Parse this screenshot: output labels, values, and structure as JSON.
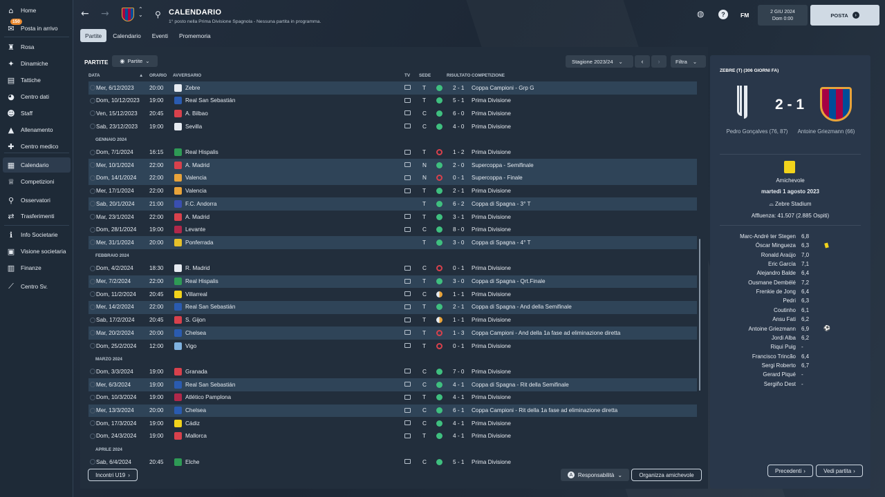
{
  "sidebar": [
    {
      "label": "Home",
      "icon": "home-icon"
    },
    {
      "label": "Posta in arrivo",
      "icon": "inbox-icon",
      "badge": "150"
    },
    {
      "label": "Rosa",
      "icon": "shirt-icon"
    },
    {
      "label": "Dinamiche",
      "icon": "megaphone-icon"
    },
    {
      "label": "Tattiche",
      "icon": "clipboard-icon"
    },
    {
      "label": "Centro dati",
      "icon": "data-icon"
    },
    {
      "label": "Staff",
      "icon": "staff-icon"
    },
    {
      "label": "Allenamento",
      "icon": "training-icon"
    },
    {
      "label": "Centro medico",
      "icon": "medical-icon"
    },
    {
      "label": "Calendario",
      "icon": "calendar-icon",
      "active": true
    },
    {
      "label": "Competizioni",
      "icon": "trophy-icon"
    },
    {
      "label": "Osservatori",
      "icon": "binoculars-icon"
    },
    {
      "label": "Trasferimenti",
      "icon": "transfer-icon"
    },
    {
      "label": "Info Societarie",
      "icon": "info-icon"
    },
    {
      "label": "Visione societaria",
      "icon": "briefcase-icon"
    },
    {
      "label": "Finanze",
      "icon": "finance-icon"
    },
    {
      "label": "Centro Sv.",
      "icon": "dev-center-icon"
    }
  ],
  "header": {
    "title": "CALENDARIO",
    "subtitle": "1° posto nella Prima Divisione Spagnola - Nessuna partita in programma.",
    "fm": "FM",
    "date": "2 GIU 2024",
    "time": "Dom 0:00",
    "posta": "POSTA"
  },
  "tabs": [
    "Partite",
    "Calendario",
    "Eventi",
    "Promemoria"
  ],
  "main": {
    "section_title": "PARTITE",
    "view_dropdown": "Partite",
    "season": "Stagione 2023/24",
    "filter": "Filtra",
    "columns": {
      "date": "DATA",
      "time": "ORARIO",
      "opponent": "AVVERSARIO",
      "tv": "TV",
      "venue": "SEDE",
      "result": "RISULTATO",
      "competition": "COMPETIZIONE"
    },
    "rows": [
      {
        "date": "Mer, 6/12/2023",
        "time": "20:00",
        "opp": "Zebre",
        "crest": "#e6ebf1",
        "tv": true,
        "venue": "T",
        "res": "w",
        "score": "2 - 1",
        "comp": "Coppa Campioni - Grp G",
        "hl": true
      },
      {
        "date": "Dom, 10/12/2023",
        "time": "19:00",
        "opp": "Real San Sebastián",
        "crest": "#2a5bb0",
        "tv": true,
        "venue": "T",
        "res": "w",
        "score": "5 - 1",
        "comp": "Prima Divisione"
      },
      {
        "date": "Ven, 15/12/2023",
        "time": "20:45",
        "opp": "A. Bilbao",
        "crest": "#d8414c",
        "tv": true,
        "venue": "C",
        "res": "w",
        "score": "6 - 0",
        "comp": "Prima Divisione"
      },
      {
        "date": "Sab, 23/12/2023",
        "time": "19:00",
        "opp": "Sevilla",
        "crest": "#e6ebf1",
        "tv": true,
        "venue": "C",
        "res": "w",
        "score": "4 - 0",
        "comp": "Prima Divisione"
      },
      {
        "month": "GENNAIO 2024"
      },
      {
        "date": "Dom, 7/1/2024",
        "time": "16:15",
        "opp": "Real Hispalis",
        "crest": "#2e9a55",
        "tv": true,
        "venue": "T",
        "res": "l",
        "score": "1 - 2",
        "comp": "Prima Divisione"
      },
      {
        "date": "Mer, 10/1/2024",
        "time": "22:00",
        "opp": "A. Madrid",
        "crest": "#d8414c",
        "tv": true,
        "venue": "N",
        "res": "w",
        "score": "2 - 0",
        "comp": "Supercoppa - Semifinale",
        "hl": true
      },
      {
        "date": "Dom, 14/1/2024",
        "time": "22:00",
        "opp": "Valencia",
        "crest": "#e8a33a",
        "tv": true,
        "venue": "N",
        "res": "l",
        "score": "0 - 1",
        "comp": "Supercoppa - Finale",
        "hl": true
      },
      {
        "date": "Mer, 17/1/2024",
        "time": "22:00",
        "opp": "Valencia",
        "crest": "#e8a33a",
        "tv": true,
        "venue": "T",
        "res": "w",
        "score": "2 - 1",
        "comp": "Prima Divisione"
      },
      {
        "date": "Sab, 20/1/2024",
        "time": "21:00",
        "opp": "F.C. Andorra",
        "crest": "#3a4fb0",
        "tv": false,
        "venue": "T",
        "res": "w",
        "score": "6 - 2",
        "comp": "Coppa di Spagna - 3° T",
        "hl": true
      },
      {
        "date": "Mar, 23/1/2024",
        "time": "22:00",
        "opp": "A. Madrid",
        "crest": "#d8414c",
        "tv": true,
        "venue": "T",
        "res": "w",
        "score": "3 - 1",
        "comp": "Prima Divisione"
      },
      {
        "date": "Dom, 28/1/2024",
        "time": "19:00",
        "opp": "Levante",
        "crest": "#b0284a",
        "tv": true,
        "venue": "C",
        "res": "w",
        "score": "8 - 0",
        "comp": "Prima Divisione"
      },
      {
        "date": "Mer, 31/1/2024",
        "time": "20:00",
        "opp": "Ponferrada",
        "crest": "#e6c12a",
        "tv": false,
        "venue": "T",
        "res": "w",
        "score": "3 - 0",
        "comp": "Coppa di Spagna - 4° T",
        "hl": true
      },
      {
        "month": "FEBBRAIO 2024"
      },
      {
        "date": "Dom, 4/2/2024",
        "time": "18:30",
        "opp": "R. Madrid",
        "crest": "#e6ebf1",
        "tv": true,
        "venue": "C",
        "res": "l",
        "score": "0 - 1",
        "comp": "Prima Divisione"
      },
      {
        "date": "Mer, 7/2/2024",
        "time": "22:00",
        "opp": "Real Hispalis",
        "crest": "#2e9a55",
        "tv": true,
        "venue": "T",
        "res": "w",
        "score": "3 - 0",
        "comp": "Coppa di Spagna - Qrt.Finale",
        "hl": true
      },
      {
        "date": "Dom, 11/2/2024",
        "time": "20:45",
        "opp": "Villarreal",
        "crest": "#f2d31b",
        "tv": true,
        "venue": "C",
        "res": "d",
        "score": "1 - 1",
        "comp": "Prima Divisione"
      },
      {
        "date": "Mer, 14/2/2024",
        "time": "22:00",
        "opp": "Real San Sebastián",
        "crest": "#2a5bb0",
        "tv": true,
        "venue": "T",
        "res": "w",
        "score": "2 - 1",
        "comp": "Coppa di Spagna - And della Semifinale",
        "hl": true
      },
      {
        "date": "Sab, 17/2/2024",
        "time": "20:45",
        "opp": "S. Gijon",
        "crest": "#d8414c",
        "tv": true,
        "venue": "T",
        "res": "d",
        "score": "1 - 1",
        "comp": "Prima Divisione"
      },
      {
        "date": "Mar, 20/2/2024",
        "time": "20:00",
        "opp": "Chelsea",
        "crest": "#2a5bb0",
        "tv": true,
        "venue": "T",
        "res": "l",
        "score": "1 - 3",
        "comp": "Coppa Campioni - And della 1a fase ad eliminazione diretta",
        "hl": true
      },
      {
        "date": "Dom, 25/2/2024",
        "time": "12:00",
        "opp": "Vigo",
        "crest": "#7fb2e0",
        "tv": true,
        "venue": "T",
        "res": "l",
        "score": "0 - 1",
        "comp": "Prima Divisione"
      },
      {
        "month": "MARZO 2024"
      },
      {
        "date": "Dom, 3/3/2024",
        "time": "19:00",
        "opp": "Granada",
        "crest": "#d8414c",
        "tv": true,
        "venue": "C",
        "res": "w",
        "score": "7 - 0",
        "comp": "Prima Divisione"
      },
      {
        "date": "Mer, 6/3/2024",
        "time": "19:00",
        "opp": "Real San Sebastián",
        "crest": "#2a5bb0",
        "tv": true,
        "venue": "C",
        "res": "w",
        "score": "4 - 1",
        "comp": "Coppa di Spagna - Rit della Semifinale",
        "hl": true
      },
      {
        "date": "Dom, 10/3/2024",
        "time": "19:00",
        "opp": "Atlético Pamplona",
        "crest": "#b0284a",
        "tv": true,
        "venue": "T",
        "res": "w",
        "score": "4 - 1",
        "comp": "Prima Divisione"
      },
      {
        "date": "Mer, 13/3/2024",
        "time": "20:00",
        "opp": "Chelsea",
        "crest": "#2a5bb0",
        "tv": true,
        "venue": "C",
        "res": "w",
        "score": "6 - 1",
        "comp": "Coppa Campioni - Rit della 1a fase ad eliminazione diretta",
        "hl": true
      },
      {
        "date": "Dom, 17/3/2024",
        "time": "19:00",
        "opp": "Cádiz",
        "crest": "#f2d31b",
        "tv": true,
        "venue": "C",
        "res": "w",
        "score": "4 - 1",
        "comp": "Prima Divisione"
      },
      {
        "date": "Dom, 24/3/2024",
        "time": "19:00",
        "opp": "Mallorca",
        "crest": "#d8414c",
        "tv": true,
        "venue": "T",
        "res": "w",
        "score": "4 - 1",
        "comp": "Prima Divisione"
      },
      {
        "month": "APRILE 2024"
      },
      {
        "date": "Sab, 6/4/2024",
        "time": "20:45",
        "opp": "Elche",
        "crest": "#2e9a55",
        "tv": true,
        "venue": "C",
        "res": "w",
        "score": "5 - 1",
        "comp": "Prima Divisione"
      }
    ],
    "u19": "Incontri U19",
    "responsabilita": "Responsabilità",
    "organizza": "Organizza amichevole"
  },
  "match": {
    "title": "ZEBRE (T) (306 GIORNI FA)",
    "score": "2 - 1",
    "home_scorer": "Pedro Gonçalves (76, 87)",
    "away_scorer": "Antoine Griezmann (66)",
    "competition": "Amichevole",
    "date": "martedì 1 agosto 2023",
    "stadium": "Zebre Stadium",
    "attendance": "Affluenza: 41.507 (2.885 Ospiti)",
    "players": [
      {
        "name": "Marc-André ter Stegen",
        "rating": "6,8"
      },
      {
        "name": "Óscar Mingueza",
        "rating": "6,3",
        "yellow": true
      },
      {
        "name": "Ronald Araújo",
        "rating": "7,0"
      },
      {
        "name": "Eric García",
        "rating": "7,1"
      },
      {
        "name": "Alejandro Balde",
        "rating": "6,4"
      },
      {
        "name": "Ousmane Dembélé",
        "rating": "7,2"
      },
      {
        "name": "Frenkie de Jong",
        "rating": "6,4"
      },
      {
        "name": "Pedri",
        "rating": "6,3"
      },
      {
        "name": "Coutinho",
        "rating": "6,1"
      },
      {
        "name": "Ansu Fati",
        "rating": "6,2"
      },
      {
        "name": "Antoine Griezmann",
        "rating": "6,9",
        "goal": true
      },
      {
        "name": "Jordi Alba",
        "rating": "6,2"
      },
      {
        "name": "Riqui Puig",
        "rating": "-"
      },
      {
        "name": "Francisco Trincão",
        "rating": "6,4"
      },
      {
        "name": "Sergi Roberto",
        "rating": "6,7"
      },
      {
        "name": "Gerard Piqué",
        "rating": "-"
      },
      {
        "name": "Sergiño Dest",
        "rating": "-"
      }
    ],
    "prev_btn": "Precedenti",
    "view_btn": "Vedi partita"
  }
}
